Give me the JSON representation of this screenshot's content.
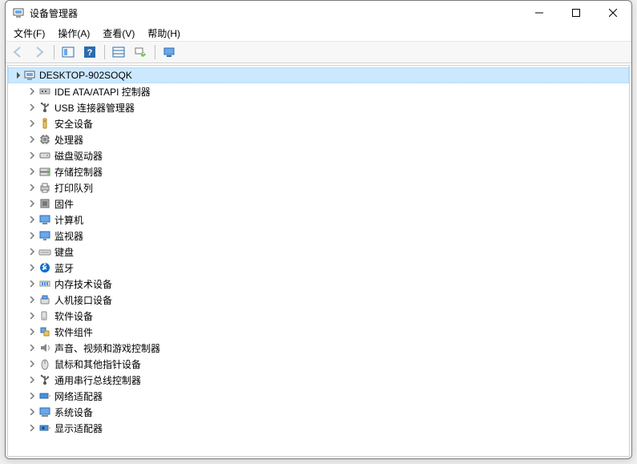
{
  "window": {
    "title": "设备管理器"
  },
  "menu": {
    "items": [
      {
        "label": "文件(F)"
      },
      {
        "label": "操作(A)"
      },
      {
        "label": "查看(V)"
      },
      {
        "label": "帮助(H)"
      }
    ]
  },
  "toolbar": {
    "back": "back",
    "forward": "forward",
    "show_hide": "show-hide-console-tree",
    "help": "help",
    "details": "details",
    "scan": "scan-hardware",
    "monitor": "remote"
  },
  "tree": {
    "root": {
      "label": "DESKTOP-902SOQK",
      "icon": "computer-root-icon",
      "expanded": true,
      "selected": true
    },
    "children": [
      {
        "label": "IDE ATA/ATAPI 控制器",
        "icon": "ide-controller-icon"
      },
      {
        "label": "USB 连接器管理器",
        "icon": "usb-connector-icon"
      },
      {
        "label": "安全设备",
        "icon": "security-device-icon"
      },
      {
        "label": "处理器",
        "icon": "processor-icon"
      },
      {
        "label": "磁盘驱动器",
        "icon": "disk-drive-icon"
      },
      {
        "label": "存储控制器",
        "icon": "storage-controller-icon"
      },
      {
        "label": "打印队列",
        "icon": "print-queue-icon"
      },
      {
        "label": "固件",
        "icon": "firmware-icon"
      },
      {
        "label": "计算机",
        "icon": "computer-icon"
      },
      {
        "label": "监视器",
        "icon": "monitor-icon"
      },
      {
        "label": "键盘",
        "icon": "keyboard-icon"
      },
      {
        "label": "蓝牙",
        "icon": "bluetooth-icon"
      },
      {
        "label": "内存技术设备",
        "icon": "memory-tech-icon"
      },
      {
        "label": "人机接口设备",
        "icon": "hid-icon"
      },
      {
        "label": "软件设备",
        "icon": "software-device-icon"
      },
      {
        "label": "软件组件",
        "icon": "software-component-icon"
      },
      {
        "label": "声音、视频和游戏控制器",
        "icon": "audio-icon"
      },
      {
        "label": "鼠标和其他指针设备",
        "icon": "mouse-icon"
      },
      {
        "label": "通用串行总线控制器",
        "icon": "usb-controller-icon"
      },
      {
        "label": "网络适配器",
        "icon": "network-adapter-icon"
      },
      {
        "label": "系统设备",
        "icon": "system-device-icon"
      },
      {
        "label": "显示适配器",
        "icon": "display-adapter-icon"
      }
    ]
  }
}
